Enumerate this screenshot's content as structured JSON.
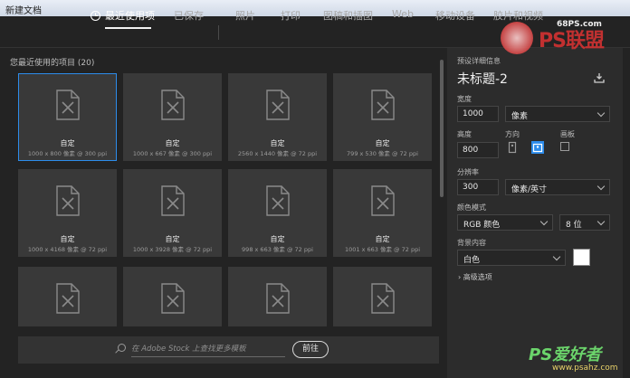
{
  "window": {
    "title": "新建文档"
  },
  "tabs": [
    {
      "label": "最近使用项",
      "active": true
    },
    {
      "label": "已保存"
    },
    {
      "label": "照片"
    },
    {
      "label": "打印"
    },
    {
      "label": "图稿和插图"
    },
    {
      "label": "Web"
    },
    {
      "label": "移动设备"
    },
    {
      "label": "胶片和视频"
    }
  ],
  "recent": {
    "title": "您最近使用的项目",
    "count": "(20)",
    "items": [
      {
        "name": "自定",
        "size": "1000 x 800 像素 @ 300 ppi",
        "selected": true
      },
      {
        "name": "自定",
        "size": "1000 x 667 像素 @ 300 ppi"
      },
      {
        "name": "自定",
        "size": "2560 x 1440 像素 @ 72 ppi"
      },
      {
        "name": "自定",
        "size": "799 x 530 像素 @ 72 ppi"
      },
      {
        "name": "自定",
        "size": "1000 x 4168 像素 @ 72 ppi"
      },
      {
        "name": "自定",
        "size": "1000 x 3928 像素 @ 72 ppi"
      },
      {
        "name": "自定",
        "size": "998 x 663 像素 @ 72 ppi"
      },
      {
        "name": "自定",
        "size": "1001 x 663 像素 @ 72 ppi"
      },
      {
        "name": "",
        "size": ""
      },
      {
        "name": "",
        "size": ""
      },
      {
        "name": "",
        "size": ""
      },
      {
        "name": "",
        "size": ""
      }
    ]
  },
  "stock": {
    "placeholder": "在 Adobe Stock 上查找更多模板",
    "go_label": "前往"
  },
  "preset": {
    "section_label": "预设详细信息",
    "doc_name": "未标题-2",
    "width_label": "宽度",
    "width_value": "1000",
    "width_unit": "像素",
    "height_label": "高度",
    "height_value": "800",
    "orientation_label": "方向",
    "artboard_label": "画板",
    "resolution_label": "分辨率",
    "resolution_value": "300",
    "resolution_unit": "像素/英寸",
    "color_mode_label": "颜色模式",
    "color_mode_value": "RGB 颜色",
    "bit_depth_value": "8 位",
    "background_label": "背景内容",
    "background_value": "白色",
    "background_color": "#ffffff",
    "advanced_label": "高级选项"
  },
  "brand": {
    "logo_text": "PS联盟",
    "logo_domain": "68PS.com",
    "watermark_text": "PS爱好者",
    "watermark_domain": "www.psahz.com"
  },
  "colors": {
    "accent": "#2d8ceb",
    "panel": "#2c2c2c",
    "card": "#393939"
  }
}
